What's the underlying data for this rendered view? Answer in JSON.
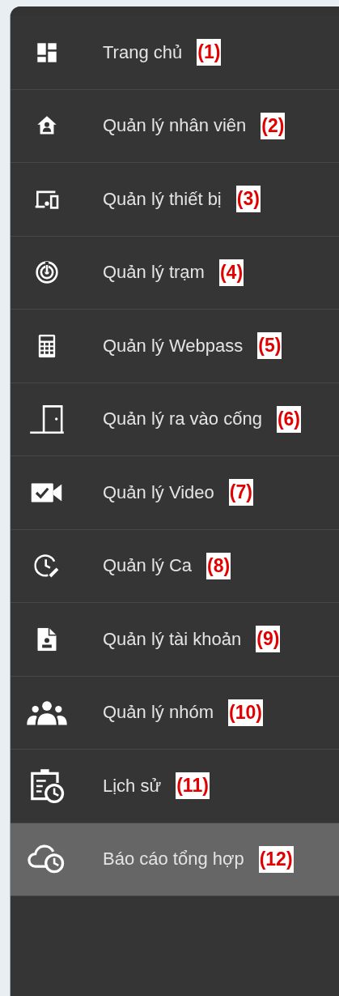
{
  "menu": {
    "items": [
      {
        "label": "Trang chủ",
        "badge": "(1)",
        "selected": false
      },
      {
        "label": "Quản lý nhân viên",
        "badge": "(2)",
        "selected": false
      },
      {
        "label": "Quản lý thiết bị",
        "badge": "(3)",
        "selected": false
      },
      {
        "label": "Quản lý trạm",
        "badge": "(4)",
        "selected": false
      },
      {
        "label": "Quản lý Webpass",
        "badge": "(5)",
        "selected": false
      },
      {
        "label": "Quản lý ra vào cống",
        "badge": "(6)",
        "selected": false
      },
      {
        "label": "Quản lý Video",
        "badge": "(7)",
        "selected": false
      },
      {
        "label": "Quản lý Ca",
        "badge": "(8)",
        "selected": false
      },
      {
        "label": "Quản lý tài khoản",
        "badge": "(9)",
        "selected": false
      },
      {
        "label": "Quản lý nhóm",
        "badge": "(10)",
        "selected": false
      },
      {
        "label": "Lịch sử",
        "badge": "(11)",
        "selected": false
      },
      {
        "label": "Báo cáo tổng hợp",
        "badge": "(12)",
        "selected": true
      }
    ]
  }
}
